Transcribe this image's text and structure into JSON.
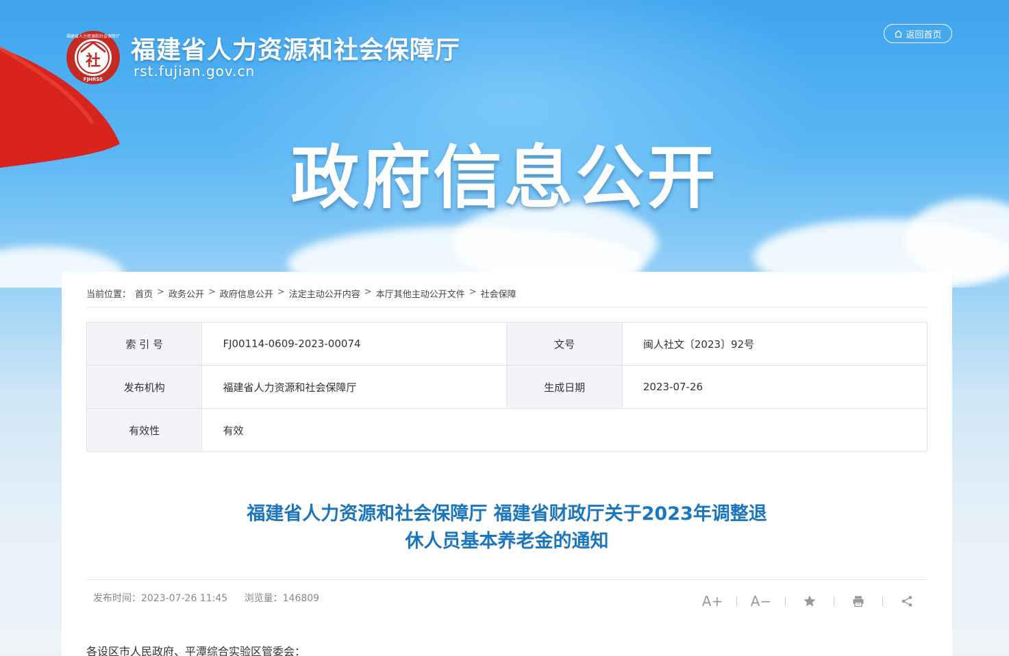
{
  "header": {
    "site_title": "福建省人力资源和社会保障厅",
    "site_domain": "rst.fujian.gov.cn",
    "logo_char": "社",
    "logo_ring_text": "福建省人力资源和社会保障厅",
    "logo_bottom_text": "FJHRSS",
    "home_label": "返回首页",
    "banner_title": "政府信息公开"
  },
  "breadcrumb": {
    "prefix": "当前位置：",
    "items": [
      "首页",
      "政务公开",
      "政府信息公开",
      "法定主动公开内容",
      "本厅其他主动公开文件",
      "社会保障"
    ],
    "separator": ">"
  },
  "info_table": {
    "index_label": "索 引 号",
    "index_value": "FJ00114-0609-2023-00074",
    "docno_label": "文号",
    "docno_value": "闽人社文〔2023〕92号",
    "org_label": "发布机构",
    "org_value": "福建省人力资源和社会保障厅",
    "date_label": "生成日期",
    "date_value": "2023-07-26",
    "valid_label": "有效性",
    "valid_value": "有效"
  },
  "article": {
    "title_line1": "福建省人力资源和社会保障厅 福建省财政厅关于2023年调整退",
    "title_line2": "休人员基本养老金的通知",
    "publish_label": "发布时间：",
    "publish_time": "2023-07-26 11:45",
    "views_label": "浏览量：",
    "views": "146809",
    "tools": {
      "font_up": "A+",
      "font_down": "A−"
    },
    "greeting": "各设区市人民政府、平潭综合实验区管委会："
  },
  "colors": {
    "title_blue": "#1b76c0",
    "flag_red": "#d8241c",
    "logo_red": "#c22a22"
  },
  "icons": [
    "home-icon",
    "star-icon",
    "print-icon",
    "share-icon"
  ]
}
